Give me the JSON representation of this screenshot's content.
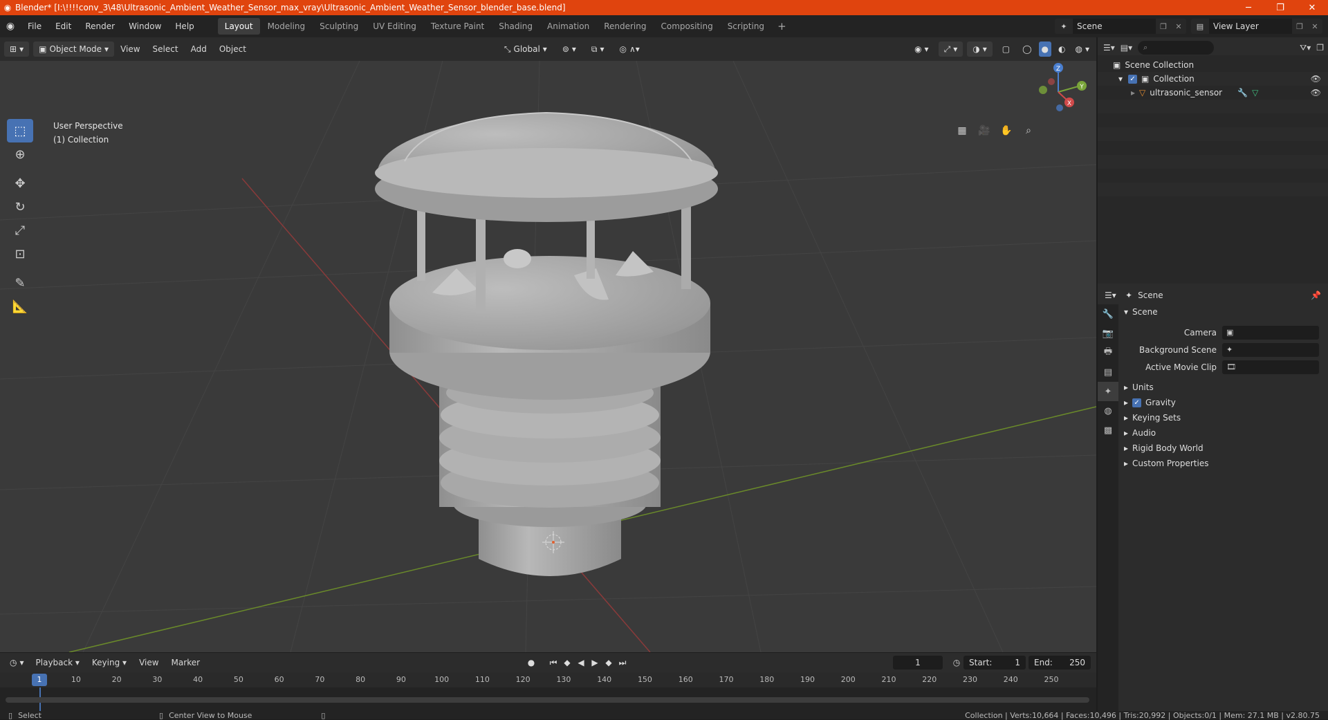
{
  "titlebar": {
    "title": "Blender* [I:\\!!!!conv_3\\48\\Ultrasonic_Ambient_Weather_Sensor_max_vray\\Ultrasonic_Ambient_Weather_Sensor_blender_base.blend]",
    "minimize": "─",
    "maximize": "❐",
    "close": "✕"
  },
  "menubar": {
    "menus": [
      "File",
      "Edit",
      "Render",
      "Window",
      "Help"
    ],
    "workspaces": [
      "Layout",
      "Modeling",
      "Sculpting",
      "UV Editing",
      "Texture Paint",
      "Shading",
      "Animation",
      "Rendering",
      "Compositing",
      "Scripting"
    ],
    "active_workspace": "Layout",
    "add_workspace": "+",
    "scene": "Scene",
    "view_layer": "View Layer"
  },
  "viewport_header": {
    "mode": "Object Mode",
    "menus": [
      "View",
      "Select",
      "Add",
      "Object"
    ],
    "transform_orientation": "Global"
  },
  "viewport": {
    "perspective_label": "User Perspective",
    "collection_label": "(1) Collection",
    "gizmo": {
      "x": "X",
      "y": "Y",
      "z": "Z"
    },
    "colors": {
      "background": "#3a3a3a",
      "x_axis": "#8a3a3a",
      "y_axis": "#6a8a2a",
      "model": "#a8a8a8"
    }
  },
  "outliner": {
    "search_placeholder": "",
    "rows": [
      {
        "label": "Scene Collection",
        "indent": 0
      },
      {
        "label": "Collection",
        "indent": 1
      },
      {
        "label": "ultrasonic_sensor",
        "indent": 2
      }
    ]
  },
  "properties": {
    "header": "Scene",
    "section": "Scene",
    "fields": [
      {
        "label": "Camera",
        "value": ""
      },
      {
        "label": "Background Scene",
        "value": ""
      },
      {
        "label": "Active Movie Clip",
        "value": ""
      }
    ],
    "panels": [
      "Units",
      "Gravity",
      "Keying Sets",
      "Audio",
      "Rigid Body World",
      "Custom Properties"
    ]
  },
  "timeline": {
    "menus": [
      "Playback",
      "Keying",
      "View",
      "Marker"
    ],
    "current_frame": "1",
    "start_label": "Start:",
    "start": "1",
    "end_label": "End:",
    "end": "250",
    "ticks": [
      "1",
      "10",
      "20",
      "30",
      "40",
      "50",
      "60",
      "70",
      "80",
      "90",
      "100",
      "110",
      "120",
      "130",
      "140",
      "150",
      "160",
      "170",
      "180",
      "190",
      "200",
      "210",
      "220",
      "230",
      "240",
      "250"
    ]
  },
  "statusbar": {
    "left_action": "Select",
    "middle_action": "Center View to Mouse",
    "stats": "Collection | Verts:10,664 | Faces:10,496 | Tris:20,992 | Objects:0/1 | Mem: 27.1 MB | v2.80.75"
  }
}
